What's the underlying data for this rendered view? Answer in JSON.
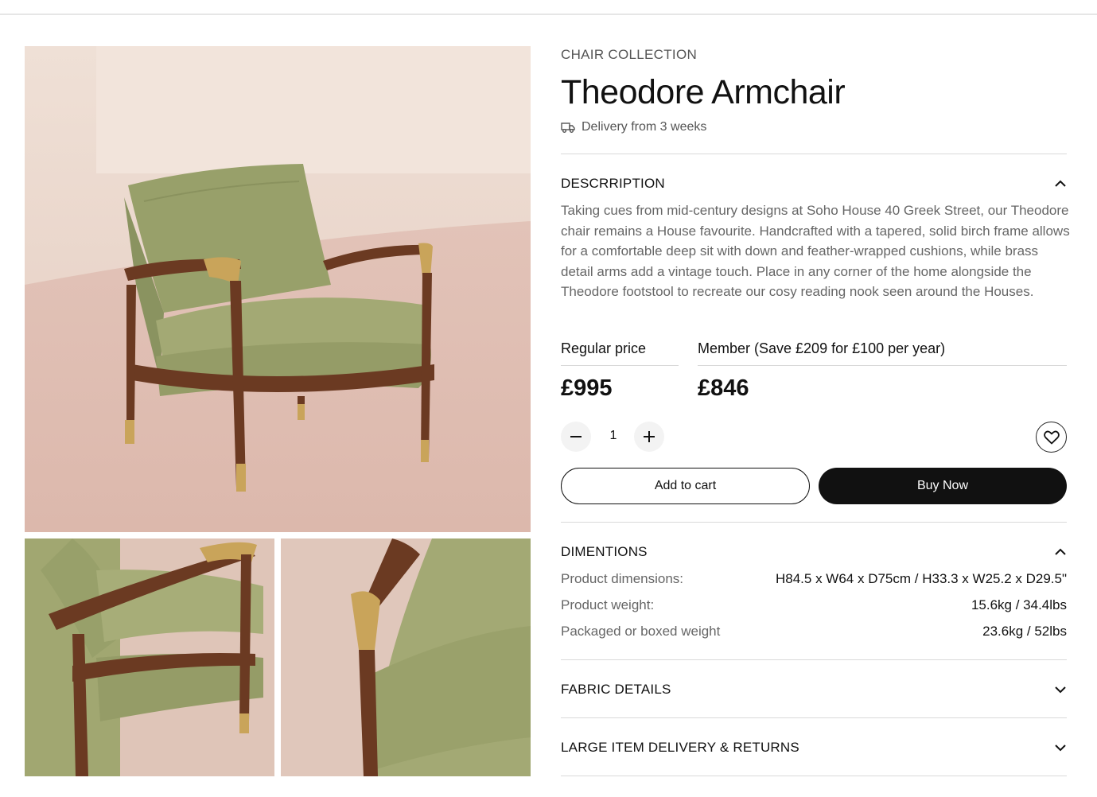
{
  "product": {
    "collection": "CHAIR COLLECTION",
    "name": "Theodore Armchair",
    "delivery": "Delivery from 3 weeks"
  },
  "description": {
    "heading": "DESCRRIPTION",
    "text": "Taking cues from mid-century designs at Soho House 40 Greek Street, our Theodore chair remains a House favourite. Handcrafted with a tapered, solid birch frame allows for a comfortable deep sit with down and feather-wrapped cushions, while brass detail arms add a vintage touch. Place in any corner of the home alongside the Theodore footstool to recreate our cosy reading nook seen around the Houses."
  },
  "pricing": {
    "regular_label": "Regular price",
    "regular_price": "£995",
    "member_label": "Member (Save £209 for £100 per year)",
    "member_price": "£846"
  },
  "quantity": {
    "value": "1"
  },
  "actions": {
    "add_to_cart": "Add to cart",
    "buy_now": "Buy Now"
  },
  "dimensions": {
    "heading": "DIMENTIONS",
    "rows": [
      {
        "label": "Product dimensions:",
        "value": "H84.5 x W64 x D75cm / H33.3 x W25.2 x D29.5\""
      },
      {
        "label": "Product weight:",
        "value": "15.6kg / 34.4lbs"
      },
      {
        "label": "Packaged or boxed weight",
        "value": "23.6kg / 52lbs"
      }
    ]
  },
  "accordions": [
    {
      "heading": "FABRIC DETAILS"
    },
    {
      "heading": "LARGE ITEM DELIVERY & RETURNS"
    }
  ],
  "icons": {
    "delivery": "truck-icon",
    "collapse": "chevron-up-icon",
    "expand": "chevron-down-icon",
    "decrease": "minus-icon",
    "increase": "plus-icon",
    "wishlist": "heart-icon"
  },
  "colors": {
    "primary_button": "#111111",
    "fabric": "#9ba16c",
    "wood": "#6b3a22",
    "brass": "#c9a45a",
    "backdrop": "#ead7cc"
  }
}
